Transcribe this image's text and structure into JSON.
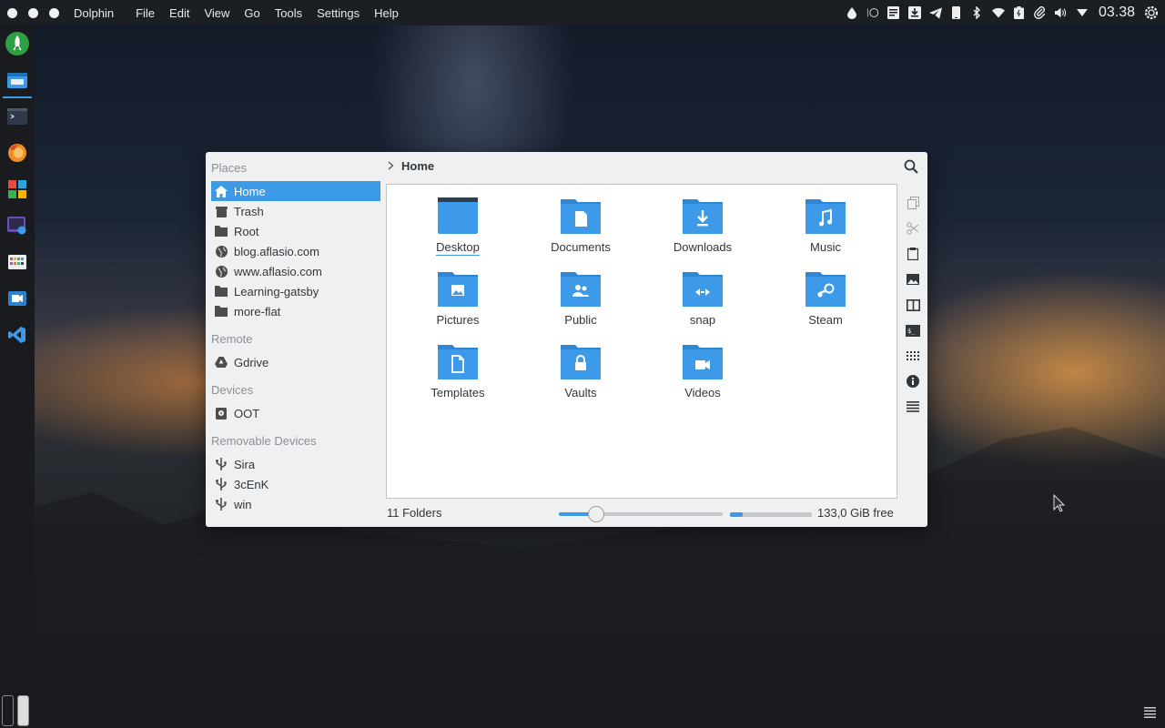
{
  "topbar": {
    "app_name": "Dolphin",
    "menu": [
      "File",
      "Edit",
      "View",
      "Go",
      "Tools",
      "Settings",
      "Help"
    ],
    "clock": "03.38",
    "tray_icons": [
      "drop-icon",
      "circle-icon",
      "notes-icon",
      "download-icon",
      "telegram-icon",
      "phone-icon",
      "bluetooth-icon",
      "wifi-icon",
      "battery-icon",
      "clip-icon",
      "volume-icon",
      "arrow-down-icon",
      "gear-icon"
    ]
  },
  "dock": {
    "items": [
      "rocket-launcher-icon",
      "dolphin-icon",
      "terminal-icon",
      "firefox-icon",
      "app-grid-icon",
      "screenshot-icon",
      "color-palette-icon",
      "video-icon",
      "vscode-icon"
    ]
  },
  "places": {
    "sections": [
      {
        "title": "Places",
        "items": [
          {
            "label": "Home",
            "icon": "home-icon",
            "selected": true
          },
          {
            "label": "Trash",
            "icon": "trash-icon"
          },
          {
            "label": "Root",
            "icon": "folder-icon"
          },
          {
            "label": "blog.aflasio.com",
            "icon": "globe-icon"
          },
          {
            "label": "www.aflasio.com",
            "icon": "globe-icon"
          },
          {
            "label": "Learning-gatsby",
            "icon": "folder-icon"
          },
          {
            "label": "more-flat",
            "icon": "folder-icon"
          }
        ]
      },
      {
        "title": "Remote",
        "items": [
          {
            "label": "Gdrive",
            "icon": "gdrive-icon"
          }
        ]
      },
      {
        "title": "Devices",
        "items": [
          {
            "label": "OOT",
            "icon": "harddisk-icon"
          }
        ]
      },
      {
        "title": "Removable Devices",
        "items": [
          {
            "label": "Sira",
            "icon": "usb-icon"
          },
          {
            "label": "3cEnK",
            "icon": "usb-icon"
          },
          {
            "label": "win",
            "icon": "usb-icon"
          }
        ]
      }
    ]
  },
  "breadcrumb": {
    "current": "Home"
  },
  "folders": [
    {
      "label": "Desktop",
      "icon": "desktop-folder-icon"
    },
    {
      "label": "Documents",
      "icon": "documents-folder-icon"
    },
    {
      "label": "Downloads",
      "icon": "downloads-folder-icon"
    },
    {
      "label": "Music",
      "icon": "music-folder-icon"
    },
    {
      "label": "Pictures",
      "icon": "pictures-folder-icon"
    },
    {
      "label": "Public",
      "icon": "public-folder-icon"
    },
    {
      "label": "snap",
      "icon": "snap-folder-icon"
    },
    {
      "label": "Steam",
      "icon": "steam-folder-icon"
    },
    {
      "label": "Templates",
      "icon": "templates-folder-icon"
    },
    {
      "label": "Vaults",
      "icon": "vaults-folder-icon"
    },
    {
      "label": "Videos",
      "icon": "videos-folder-icon"
    }
  ],
  "toolstrip": [
    "copy-icon",
    "cut-icon",
    "paste-icon",
    "preview-icon",
    "split-view-icon",
    "terminal-panel-icon",
    "icons-view-icon",
    "info-icon",
    "details-view-icon"
  ],
  "status": {
    "folder_count": "11 Folders",
    "zoom_fraction": 0.2,
    "disk_used_fraction": 0.15,
    "free_space": "133,0 GiB free"
  },
  "colors": {
    "accent": "#3d9ae8",
    "folder": "#3d9ae8"
  }
}
